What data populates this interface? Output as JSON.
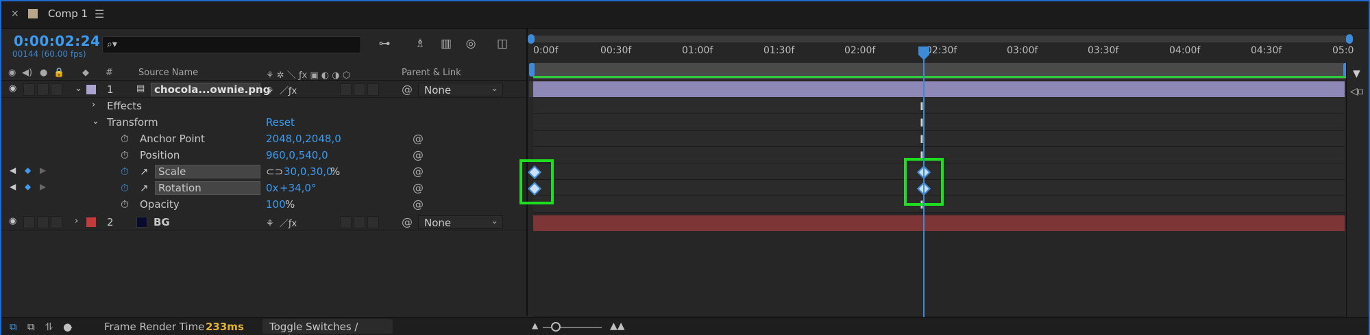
{
  "tab": {
    "close": "×",
    "title": "Comp 1",
    "menu": "☰"
  },
  "header": {
    "timecode": "0:00:02:24",
    "frame_info": "00144 (60.00 fps)",
    "search_placeholder": ""
  },
  "columns": {
    "num": "#",
    "source_name": "Source Name",
    "parent_link": "Parent & Link"
  },
  "layers": [
    {
      "index": "1",
      "name": "chocola...ownie.png",
      "label_color": "#a9a4cf",
      "parent": "None"
    },
    {
      "index": "2",
      "name": "BG",
      "label_color": "#c43a3a",
      "parent": "None"
    }
  ],
  "properties": {
    "effects": "Effects",
    "transform": "Transform",
    "reset": "Reset",
    "anchor_point": {
      "label": "Anchor Point",
      "value": "2048,0,2048,0"
    },
    "position": {
      "label": "Position",
      "value": "960,0,540,0"
    },
    "scale": {
      "label": "Scale",
      "value": "30,0,30,0",
      "unit": "%"
    },
    "rotation": {
      "label": "Rotation",
      "value_a": "0x",
      "value_b": "+34,0°"
    },
    "opacity": {
      "label": "Opacity",
      "value": "100",
      "unit": "%"
    }
  },
  "ruler": [
    "0:00f",
    "00:30f",
    "01:00f",
    "01:30f",
    "02:00f",
    "02:30f",
    "03:00f",
    "03:30f",
    "04:00f",
    "04:30f",
    "05:0"
  ],
  "status": {
    "render_label": "Frame Render Time",
    "render_value": "233ms",
    "toggle": "Toggle Switches / Modes"
  },
  "colors": {
    "accent": "#3d9bf0",
    "highlight": "#1fdd1f",
    "layer1": "#8e88b6",
    "layer2": "#7e3535"
  }
}
